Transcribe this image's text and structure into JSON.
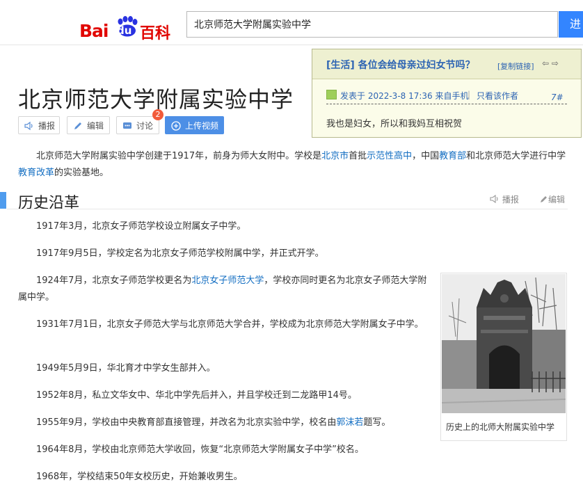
{
  "header": {
    "logo": {
      "part1": "Bai",
      "part2": "du",
      "part3": "百科"
    },
    "search_value": "北京师范大学附属实验中学",
    "search_button": "进"
  },
  "title": "北京师范大学附属实验中学",
  "toolbar": {
    "play": "播报",
    "edit": "编辑",
    "discuss": "讨论",
    "discuss_badge": "2",
    "upload": "上传视频"
  },
  "popup": {
    "tag": "[生活]",
    "question": "各位会给母亲过妇女节吗？",
    "copy_link": "[复制链接]",
    "arrows": "⇦ ⇨",
    "posted": "发表于 2022-3-8 17:36 来自手机",
    "separator": "|",
    "author_only": "只看该作者",
    "floor": "7#",
    "body": "我也是妇女，所以和我妈互相祝贺"
  },
  "intro": {
    "t1": "北京师范大学附属实验中学创建于1917年，前身为师大女附中。学校是",
    "l1": "北京市",
    "t2": "首批",
    "l2": "示范性高中",
    "t3": "，中国",
    "l3": "教育部",
    "t4": "和北京师范大学进行中学",
    "l4": "教育改革",
    "t5": "的实验基地。"
  },
  "section": {
    "title": "历史沿革",
    "play": "播报",
    "edit": "编辑"
  },
  "history": {
    "p1": "1917年3月，北京女子师范学校设立附属女子中学。",
    "p2": "1917年9月5日，学校定名为北京女子师范学校附属中学，并正式开学。",
    "p3a": "1924年7月，北京女子师范学校更名为",
    "p3link": "北京女子师范大学",
    "p3b": "，学校亦同时更名为北京女子师范大学附属中学。",
    "p4": "1931年7月1日，北京女子师范大学与北京师范大学合并，学校成为北京师范大学附属女子中学。",
    "p5": "1949年5月9日，华北育才中学女生部并入。",
    "p6": "1952年8月，私立文华女中、华北中学先后并入，并且学校迁到二龙路甲14号。",
    "p7a": "1955年9月，学校由中央教育部直接管理，并改名为北京实验中学，校名由",
    "p7link": "郭沫若",
    "p7b": "题写。",
    "p8": "1964年8月，学校由北京师范大学收回，恢复“北京师范大学附属女子中学”校名。",
    "p9": "1968年，学校结束50年女校历史，开始兼收男生。"
  },
  "image_caption": "历史上的北师大附属实验中学",
  "colors": {
    "brand_red": "#e10601",
    "brand_blue": "#2932e1",
    "link": "#136ec2",
    "accent": "#4f9cee"
  }
}
